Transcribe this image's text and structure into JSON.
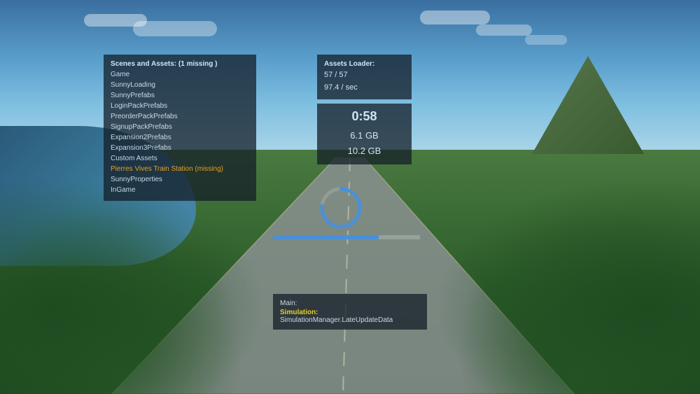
{
  "background": {
    "description": "Cities: Skylines aerial landscape screenshot"
  },
  "scenes_panel": {
    "title": "Scenes and Assets: (1 missing )",
    "items": [
      {
        "label": "Game",
        "style": "normal"
      },
      {
        "label": "SunnyLoading",
        "style": "normal"
      },
      {
        "label": "SunnyPrefabs",
        "style": "normal"
      },
      {
        "label": "LoginPackPrefabs",
        "style": "normal"
      },
      {
        "label": "PreorderPackPrefabs",
        "style": "normal"
      },
      {
        "label": "SignupPackPrefabs",
        "style": "normal"
      },
      {
        "label": "Expansion2Prefabs",
        "style": "normal"
      },
      {
        "label": "Expansion3Prefabs",
        "style": "normal"
      },
      {
        "label": "Custom Assets",
        "style": "normal"
      },
      {
        "label": "Pierres Vives Train Station (missing)",
        "style": "missing"
      },
      {
        "label": "SunnyProperties",
        "style": "normal"
      },
      {
        "label": "InGame",
        "style": "normal"
      }
    ]
  },
  "assets_loader_panel": {
    "title": "Assets Loader:",
    "line1": "57 / 57",
    "line2": "97.4 / sec"
  },
  "timer_panel": {
    "time": "0:58",
    "memory1": "6.1 GB",
    "memory2": "10.2 GB"
  },
  "main_panel": {
    "label": "Main:",
    "simulation_label": "Simulation:",
    "simulation_value": "SimulationManager.LateUpdateData"
  },
  "progress_bar": {
    "percent": 72
  },
  "loading_circle": {
    "dasharray": 170,
    "dashoffset": 40
  }
}
